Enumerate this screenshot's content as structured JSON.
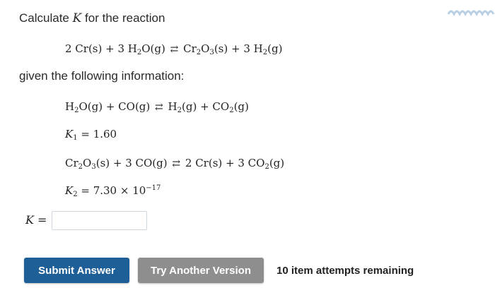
{
  "question": {
    "prefix": "Calculate ",
    "var": "K",
    "suffix": " for the reaction"
  },
  "given_text": "given the following information:",
  "main_reaction": {
    "c1": "2 Cr(s) + 3 H",
    "c2": "O(g) ",
    "c3": " Cr",
    "c4": "O",
    "c5": "(s) + 3 H",
    "c6": "(g)",
    "sub_2": "2",
    "sub_3": "3"
  },
  "reaction1": {
    "a": "H",
    "b": "O(g) + CO(g) ",
    "c": " H",
    "d": "(g) + CO",
    "e": "(g)"
  },
  "k1": {
    "var": "K",
    "sub": "1",
    "eq": " = 1.60"
  },
  "reaction2": {
    "a": "Cr",
    "b": "O",
    "c": "(s) + 3 CO(g) ",
    "d": " 2 Cr(s) + 3 CO",
    "e": "(g)"
  },
  "k2": {
    "var": "K",
    "sub": "2",
    "eq": " = 7.30 × 10",
    "exp": "−17"
  },
  "answer": {
    "label_var": "K",
    "label_eq": " =",
    "value": "",
    "placeholder": ""
  },
  "buttons": {
    "submit": "Submit Answer",
    "try_another": "Try Another Version"
  },
  "attempts_text": "10 item attempts remaining",
  "colors": {
    "submit_bg": "#1f5f97",
    "try_bg": "#8e8e8e",
    "text": "#2a2a2a"
  },
  "icons": {
    "equilibrium_arrow": "⇄"
  }
}
